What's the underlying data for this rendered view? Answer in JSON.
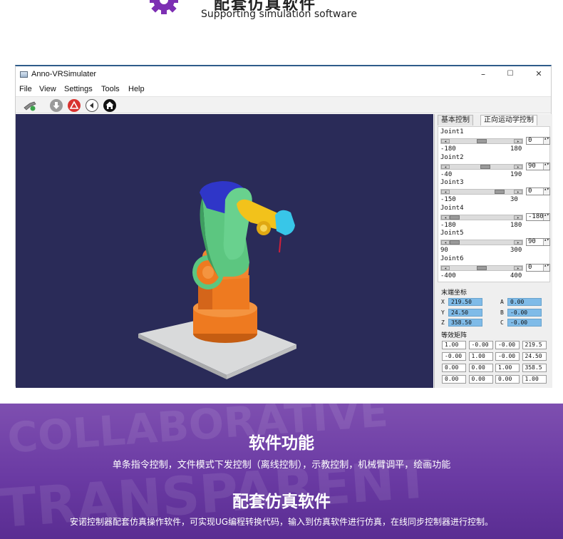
{
  "header": {
    "title": "配套仿真软件",
    "subtitle": "Supporting simulation software"
  },
  "window": {
    "title": "Anno-VRSimulater",
    "minimize": "–",
    "maximize": "☐",
    "close": "✕"
  },
  "menu": [
    "File",
    "View",
    "Settings",
    "Tools",
    "Help"
  ],
  "toolbar_icons": [
    "robot-icon",
    "download-icon",
    "alert-icon",
    "back-icon",
    "home-icon"
  ],
  "tabs": [
    "基本控制",
    "正向运动学控制"
  ],
  "joints": [
    {
      "name": "Joint1",
      "min": "-180",
      "max": "180",
      "value": "0",
      "level": 0.5
    },
    {
      "name": "Joint2",
      "min": "-40",
      "max": "190",
      "value": "90",
      "level": 0.565
    },
    {
      "name": "Joint3",
      "min": "-150",
      "max": "30",
      "value": "0",
      "level": 0.833
    },
    {
      "name": "Joint4",
      "min": "-180",
      "max": "180",
      "value": "-180",
      "level": 0.0
    },
    {
      "name": "Joint5",
      "min": "90",
      "max": "300",
      "value": "90",
      "level": 0.0
    },
    {
      "name": "Joint6",
      "min": "-400",
      "max": "400",
      "value": "0",
      "level": 0.5
    }
  ],
  "end_coords": {
    "label": "末端坐标",
    "items": [
      {
        "axis": "X",
        "value": "219.50"
      },
      {
        "axis": "Y",
        "value": "24.50"
      },
      {
        "axis": "Z",
        "value": "358.50"
      },
      {
        "axis": "A",
        "value": "0.00"
      },
      {
        "axis": "B",
        "value": "-0.00"
      },
      {
        "axis": "C",
        "value": "-0.00"
      }
    ]
  },
  "matrix": {
    "label": "等效矩阵",
    "rows": [
      [
        "1.00",
        "-0.00",
        "-0.00",
        "219.5"
      ],
      [
        "-0.00",
        "1.00",
        "-0.00",
        "24.50"
      ],
      [
        "0.00",
        "0.00",
        "1.00",
        "358.5"
      ],
      [
        "0.00",
        "0.00",
        "0.00",
        "1.00"
      ]
    ]
  },
  "banner": {
    "title1": "软件功能",
    "text1": "单条指令控制，文件模式下发控制（离线控制），示教控制，机械臂调平，绘画功能",
    "title2": "配套仿真软件",
    "text2": "安诺控制器配套仿真操作软件，可实现UG编程转换代码，输入到仿真软件进行仿真，在线同步控制器进行控制。",
    "bg_words": [
      "COLLABORATIVE",
      "TRANSPARENT"
    ]
  },
  "colors": {
    "viewport_bg": "#2a2b58",
    "arm_orange": "#ee7a20",
    "arm_green": "#5cc680",
    "arm_blue": "#2f36c8",
    "arm_yellow": "#f2c21b",
    "arm_cyan": "#38c6e8",
    "banner_purple": "#6a3aa3"
  }
}
